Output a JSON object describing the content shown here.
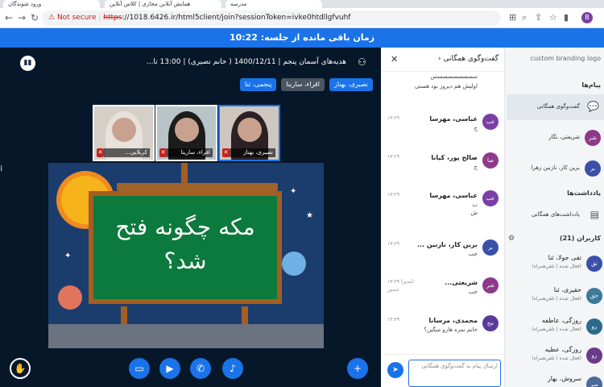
{
  "browser": {
    "tab1": "ورود شوندگان",
    "tab2": "همایش آنلاین مجازی | کلاس آنلاین",
    "tab3": "مدرسه",
    "not_secure": "Not secure",
    "url_https": "https",
    "url_rest": "://1018.6426.ir/html5client/join?sessionToken=ivke0htdllgfvuhf",
    "profile_initial": "B"
  },
  "timer": {
    "text": "زمان باقی مانده از جلسه: 10:22"
  },
  "meeting": {
    "title": "هدیه‌های آسمان پنجم | 1400/12/11 ( خانم نصیری) | 13:00 تا...",
    "speakers": [
      {
        "label": "نصیری، بهناز",
        "active": true
      },
      {
        "label": "اقراء، سارینا",
        "active": false
      },
      {
        "label": "پنجمی، ثنا",
        "active": true
      }
    ],
    "videos": [
      {
        "name": "کربلایی...",
        "hijab": "#e8e2dc"
      },
      {
        "name": "اقراء، سارینا",
        "hijab": "#1c1c1c"
      },
      {
        "name": "نصیری، بهناز",
        "hijab": "#2b2125"
      }
    ],
    "slide_text": "مکه چگونه فتح شد؟"
  },
  "chat": {
    "title": "گفت‌وگوی همگانی",
    "messages": [
      {
        "initials": "",
        "sender": "",
        "time": "",
        "text": "سسسسسسسسس",
        "text2": "اولیش هم دیروز بود هستی",
        "color": "#7a3fa4"
      },
      {
        "initials": "عب",
        "sender": "عباسی، مهرسا",
        "time": "۱۳:۲۹",
        "text": "ج",
        "text2": "",
        "color": "#7a3fa4"
      },
      {
        "initials": "صا",
        "sender": "صالح پور، کیانا",
        "time": "۱۳:۲۹",
        "text": "ج",
        "text2": "",
        "color": "#8e3a8a"
      },
      {
        "initials": "عب",
        "sender": "عباسی، مهرسا",
        "time": "۱۳:۲۹",
        "text": "ب",
        "text2": "ش",
        "color": "#7a3fa4"
      },
      {
        "initials": "بر",
        "sender": "برین کار، نازنین ...",
        "time": "۱۳:۲۹",
        "text": "جب",
        "text2": "",
        "color": "#3b4fa8"
      },
      {
        "initials": "شر",
        "sender": "شریعتی...",
        "time": "(مدیر) ۱۳:۲۹",
        "text": "حضور",
        "text2": "جب",
        "color": "#8e3a8a"
      },
      {
        "initials": "مح",
        "sender": "محمدی، مرسانا",
        "time": "۱۳:۲۹",
        "text": "خانم نمره هارو میگین؟",
        "text2": "",
        "color": "#5a3a9a"
      }
    ],
    "input_placeholder": "ارسال پیام به گفت‌وگوی همگانی"
  },
  "sidebar": {
    "brand": "custom branding logo",
    "messages_title": "پیام‌ها",
    "public_chat": "گفت‌وگوی همگانی",
    "private_chats": [
      {
        "initials": "شر",
        "label": "شریعتی، نگار",
        "color": "#8e3a8a"
      },
      {
        "initials": "بر",
        "label": "برین کار، نازنین زهرا",
        "color": "#3b4fa8"
      }
    ],
    "notes_title": "یادداشت‌ها",
    "shared_notes": "یادداشت‌های همگانی",
    "users_title": "کاربران (21)",
    "users": [
      {
        "initials": "تق",
        "name": "تقی جولا، ثنا",
        "status": "(فعال شده | تلفن‌همراه)",
        "color": "#3b4fa8"
      },
      {
        "initials": "حق",
        "name": "حقیری، ثنا",
        "status": "(فعال شده | تلفن‌همراه)",
        "color": "#3b7a9a"
      },
      {
        "initials": "رو",
        "name": "روزگی، عاطفه",
        "status": "(فعال شده | تلفن‌همراه)",
        "color": "#2a6a8a"
      },
      {
        "initials": "رو",
        "name": "روزگی، عطیه",
        "status": "(فعال شده | تلفن‌همراه)",
        "color": "#6a3a8a"
      },
      {
        "initials": "سر",
        "name": "سروش، بهار",
        "status": "",
        "color": "#4a6a9a"
      }
    ]
  }
}
